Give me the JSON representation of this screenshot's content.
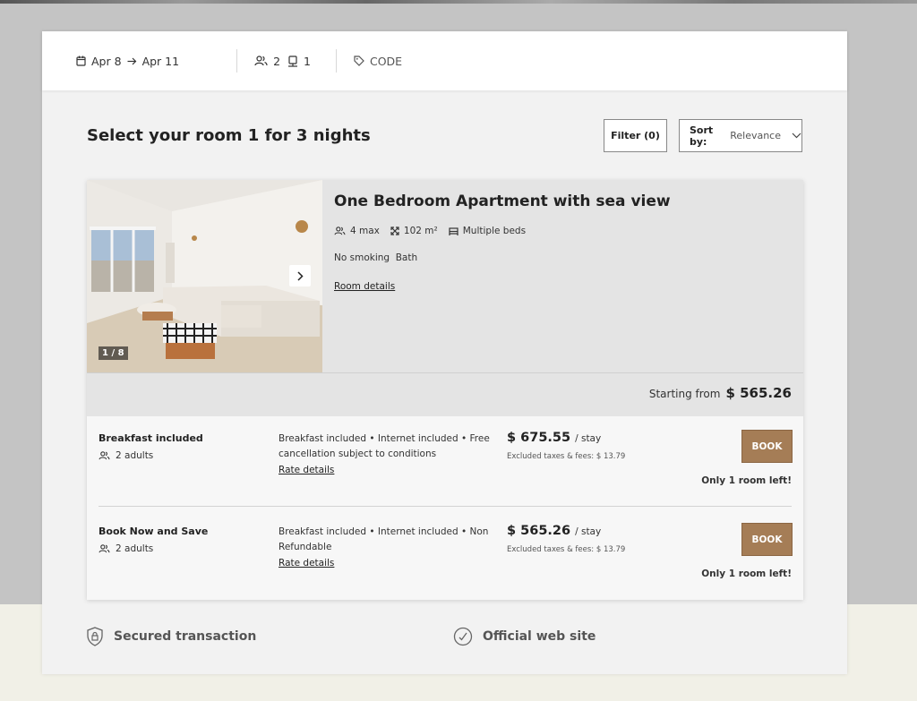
{
  "search_bar": {
    "check_in": "Apr 8",
    "check_out": "Apr 11",
    "adults": "2",
    "children": "1",
    "promo_label": "CODE"
  },
  "heading": "Select your room 1 for 3 nights",
  "filter_label": "Filter (0)",
  "sort": {
    "label": "Sort by:",
    "value": "Relevance"
  },
  "room": {
    "title": "One Bedroom Apartment with sea view",
    "max_guests": "4 max",
    "size": "102 m²",
    "beds": "Multiple beds",
    "amenities": "No smoking  Bath",
    "details_link": "Room details",
    "photo_counter": "1 / 8",
    "starting_label": "Starting from",
    "starting_price": "$ 565.26"
  },
  "rates": [
    {
      "name": "Breakfast included",
      "guests": "2 adults",
      "description": "Breakfast included • Internet included • Free cancellation subject to conditions",
      "details_link": "Rate details",
      "price": "$ 675.55",
      "unit": "/ stay",
      "taxes": "Excluded taxes & fees: $ 13.79",
      "book_label": "BOOK",
      "availability": "Only 1 room left!"
    },
    {
      "name": "Book Now and Save",
      "guests": "2 adults",
      "description": "Breakfast included • Internet included • Non Refundable",
      "details_link": "Rate details",
      "price": "$ 565.26",
      "unit": "/ stay",
      "taxes": "Excluded taxes & fees: $ 13.79",
      "book_label": "BOOK",
      "availability": "Only 1 room left!"
    }
  ],
  "footer": {
    "secured": "Secured transaction",
    "official": "Official web site"
  },
  "colors": {
    "book_button": "#a57d56",
    "panel_bg": "#f2f2f2",
    "page_bottom_bg": "#f1f0e7"
  },
  "icons": [
    "calendar-icon",
    "arrow-right-icon",
    "guests-icon",
    "child-icon",
    "tag-icon",
    "size-icon",
    "bed-icon",
    "chevron-down-icon",
    "chevron-right-icon",
    "shield-lock-icon",
    "check-circle-icon"
  ]
}
